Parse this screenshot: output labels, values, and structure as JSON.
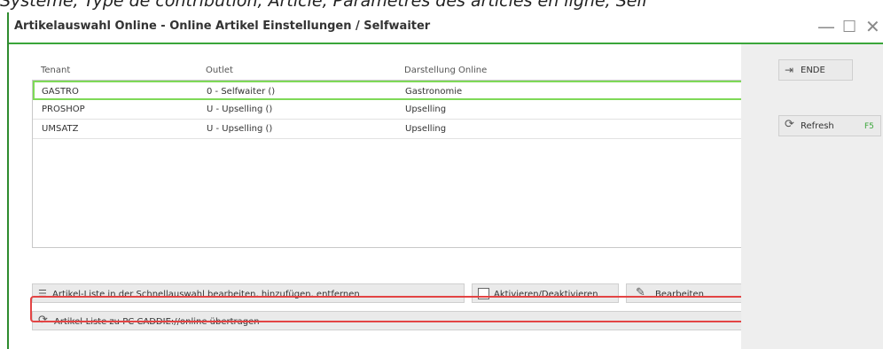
{
  "caption": "Système, Type de contribution, Article, Paramètres des articles en ligne, Self",
  "window": {
    "title": "Artikelauswahl Online - Online Artikel Einstellungen / Selfwaiter",
    "minimize": "—",
    "maximize": "☐",
    "close": "✕"
  },
  "table": {
    "headers": [
      "Tenant",
      "Outlet",
      "Darstellung Online"
    ],
    "rows": [
      {
        "tenant": "GASTRO",
        "outlet": "0 - Selfwaiter ()",
        "darstellung": "Gastronomie",
        "selected": true
      },
      {
        "tenant": "PROSHOP",
        "outlet": "U - Upselling ()",
        "darstellung": "Upselling",
        "selected": false
      },
      {
        "tenant": "UMSATZ",
        "outlet": "U - Upselling ()",
        "darstellung": "Upselling",
        "selected": false
      }
    ]
  },
  "buttons": {
    "edit_list": "Artikel-Liste in der Schnellauswahl bearbeiten, hinzufügen, entfernen",
    "activate": "Aktivieren/Deaktivieren",
    "edit": "Bearbeiten",
    "transfer": "Artikel-Liste zu PC CADDIE://online übertragen"
  },
  "side": {
    "ende": "ENDE",
    "refresh": "Refresh",
    "refresh_key": "F5"
  },
  "colors": {
    "accent_green": "#3aa63a",
    "selection_green": "#7ed957",
    "highlight_red": "#e34444"
  }
}
